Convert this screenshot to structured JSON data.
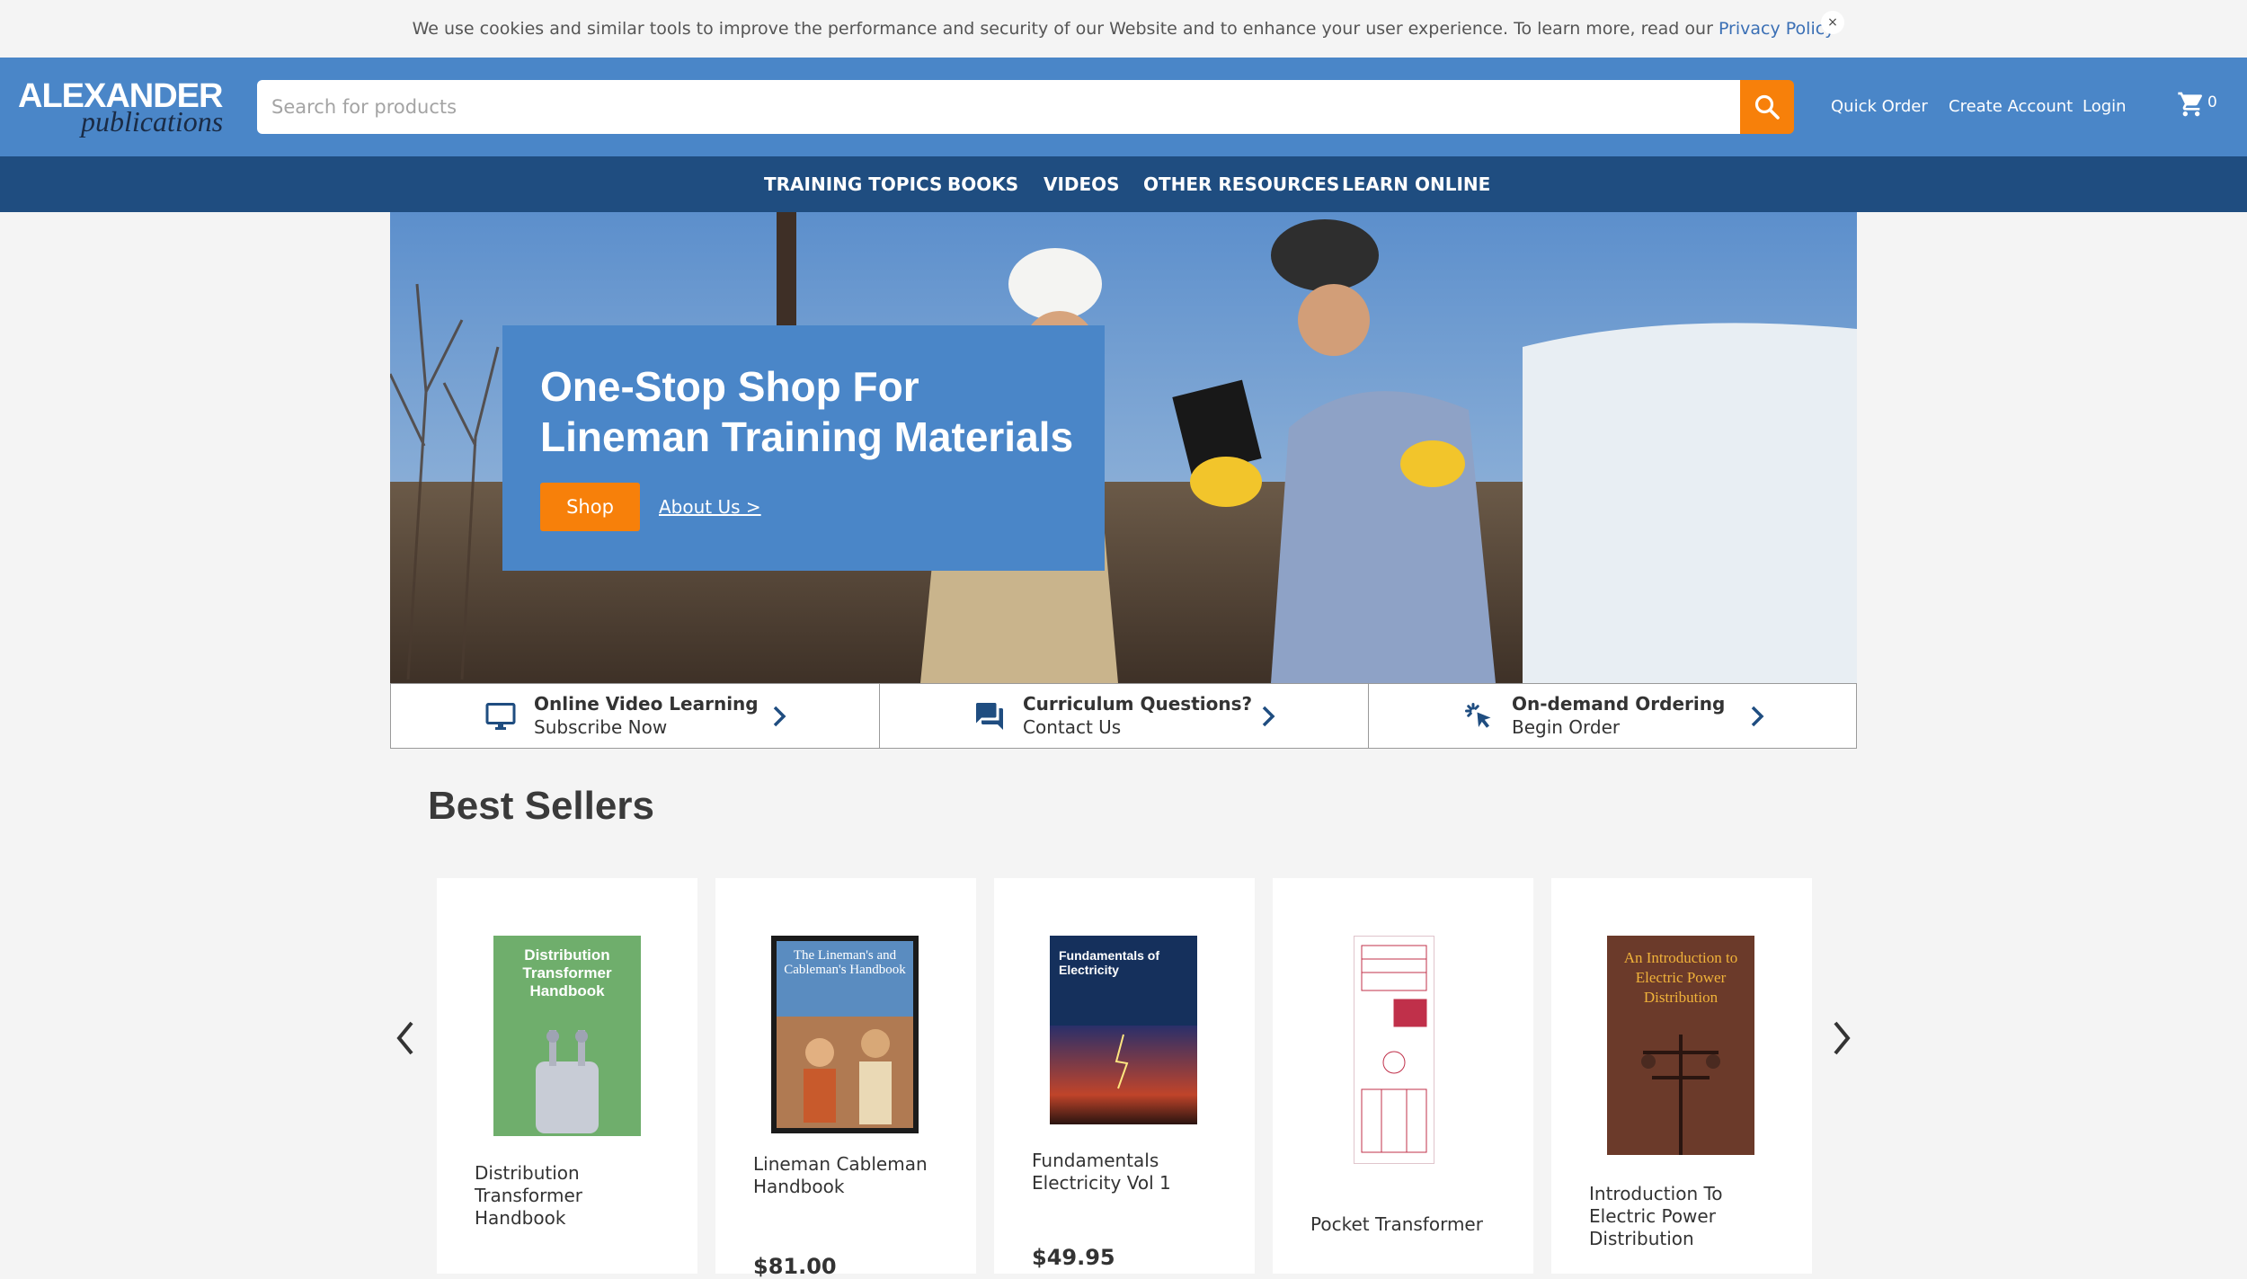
{
  "cookie": {
    "text": "We use cookies and similar tools to improve the performance and security of our Website and to enhance your user experience. To learn more, read our ",
    "link": "Privacy Policy",
    "close": "×"
  },
  "header": {
    "logo_line1": "ALEXANDER",
    "logo_line2": "publications",
    "search_placeholder": "Search for products",
    "links": [
      "Quick Order",
      "Create Account",
      "Login"
    ],
    "cart_count": "0"
  },
  "nav": [
    "TRAINING TOPICS",
    "BOOKS",
    "VIDEOS",
    "OTHER RESOURCES",
    "LEARN ONLINE"
  ],
  "hero": {
    "title": "One-Stop Shop For Lineman Training Materials",
    "shop_button": "Shop",
    "about_link": "About Us >"
  },
  "features": [
    {
      "title": "Online Video Learning",
      "subtitle": "Subscribe Now",
      "icon": "monitor-icon"
    },
    {
      "title": "Curriculum Questions?",
      "subtitle": "Contact Us",
      "icon": "chat-icon"
    },
    {
      "title": "On-demand Ordering",
      "subtitle": "Begin Order",
      "icon": "click-icon"
    }
  ],
  "best_sellers": {
    "title": "Best Sellers",
    "products": [
      {
        "name": "Distribution Transformer Handbook",
        "price": "",
        "cover_text": "Distribution Transformer Handbook"
      },
      {
        "name": "Lineman Cableman Handbook",
        "price": "$81.00",
        "cover_text": "The Lineman's and Cableman's Handbook"
      },
      {
        "name": "Fundamentals Electricity Vol 1",
        "price": "$49.95",
        "cover_text": "Fundamentals of Electricity"
      },
      {
        "name": "Pocket Transformer",
        "price": "",
        "cover_text": ""
      },
      {
        "name": "Introduction To Electric Power Distribution",
        "price": "",
        "cover_text": "An Introduction to Electric Power Distribution"
      }
    ]
  },
  "colors": {
    "header_blue": "#4a86c8",
    "nav_navy": "#1f4d80",
    "accent_orange": "#f7800a"
  }
}
